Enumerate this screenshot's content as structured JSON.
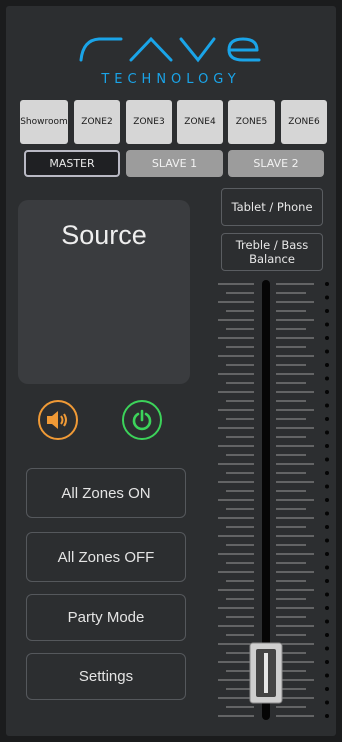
{
  "logo": {
    "text": "rave",
    "subtitle": "TECHNOLOGY",
    "color": "#1aa4e8"
  },
  "zones": [
    "Showroom",
    "ZONE2",
    "ZONE3",
    "ZONE4",
    "ZONE5",
    "ZONE6"
  ],
  "master_slave": [
    {
      "label": "MASTER",
      "active": true
    },
    {
      "label": "SLAVE 1",
      "active": false
    },
    {
      "label": "SLAVE 2",
      "active": false
    }
  ],
  "source": {
    "label": "Source"
  },
  "icons": {
    "speaker": "speaker-icon",
    "power": "power-icon",
    "speaker_color": "#f09a36",
    "power_color": "#3cd35a"
  },
  "actions": {
    "all_on": "All Zones ON",
    "all_off": "All Zones OFF",
    "party": "Party Mode",
    "settings": "Settings"
  },
  "side": {
    "tablet": "Tablet / Phone",
    "treble_line1": "Treble / Bass",
    "treble_line2": "Balance"
  },
  "volume": {
    "level": 0.05
  }
}
